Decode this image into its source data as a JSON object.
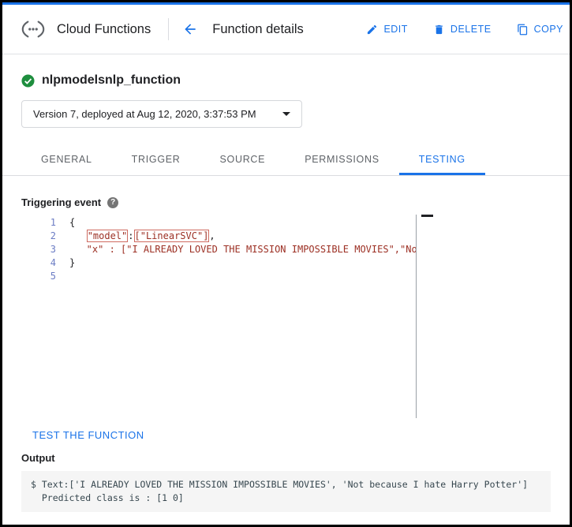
{
  "colors": {
    "accent_blue": "#1a73e8",
    "success_green": "#1e8e3e",
    "code_string_red": "#9c2f23",
    "output_background": "#f5f5f5"
  },
  "header": {
    "product": "Cloud Functions",
    "page_title": "Function details",
    "back_icon": "back-arrow-icon",
    "logo_icon": "cloud-functions-logo-icon",
    "actions": [
      {
        "label": "EDIT",
        "icon": "pencil-icon"
      },
      {
        "label": "DELETE",
        "icon": "trash-icon"
      },
      {
        "label": "COPY",
        "icon": "copy-icon"
      }
    ]
  },
  "function": {
    "name": "nlpmodelsnlp_function",
    "status_icon": "green-check-icon",
    "version": "Version 7, deployed at Aug 12, 2020, 3:37:53 PM"
  },
  "tabs": [
    {
      "label": "GENERAL",
      "active": false
    },
    {
      "label": "TRIGGER",
      "active": false
    },
    {
      "label": "SOURCE",
      "active": false
    },
    {
      "label": "PERMISSIONS",
      "active": false
    },
    {
      "label": "TESTING",
      "active": true
    }
  ],
  "testing": {
    "triggering_event_label": "Triggering event",
    "help_icon": "help-question-icon",
    "editor": {
      "lines": [
        {
          "num": "1",
          "code": "{"
        },
        {
          "num": "2",
          "indent": "   ",
          "key": "\"model\"",
          "colon": ":",
          "value": "[\"LinearSVC\"]",
          "comma": ","
        },
        {
          "num": "3",
          "code": "   \"x\" : [\"I ALREADY LOVED THE MISSION IMPOSSIBLE MOVIES\",\"Not"
        },
        {
          "num": "4",
          "code": "}"
        },
        {
          "num": "5",
          "code": ""
        }
      ]
    },
    "test_button_label": "TEST THE FUNCTION",
    "output_label": "Output",
    "output_lines": [
      "$ Text:['I ALREADY LOVED THE MISSION IMPOSSIBLE MOVIES', 'Not because I hate Harry Potter']",
      "  Predicted class is : [1 0]"
    ]
  }
}
